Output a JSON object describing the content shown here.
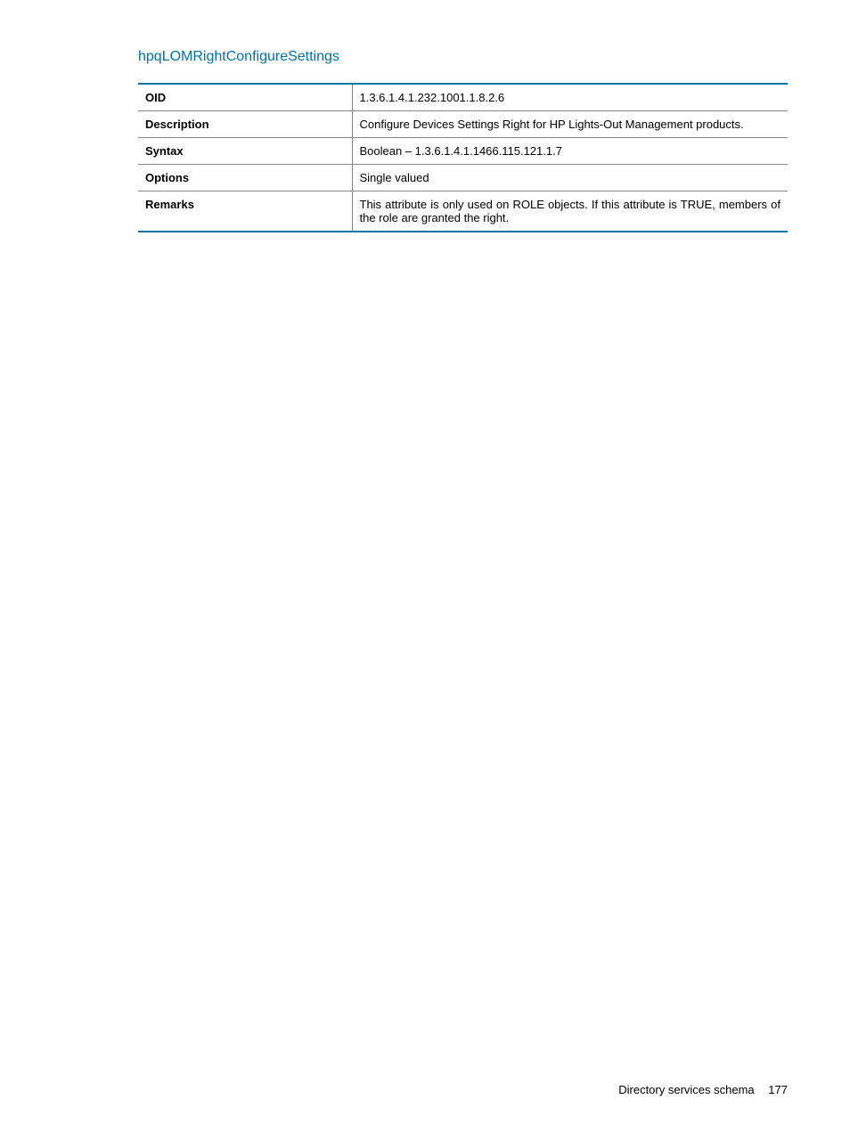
{
  "section_title": "hpqLOMRightConfigureSettings",
  "table_rows": [
    {
      "key": "OID",
      "value": "1.3.6.1.4.1.232.1001.1.8.2.6"
    },
    {
      "key": "Description",
      "value": "Configure Devices Settings Right for HP Lights-Out Management products."
    },
    {
      "key": "Syntax",
      "value": "Boolean – 1.3.6.1.4.1.1466.115.121.1.7"
    },
    {
      "key": "Options",
      "value": "Single valued"
    },
    {
      "key": "Remarks",
      "value": "This attribute is only used on ROLE objects. If this attribute is TRUE, members of the role are granted the right."
    }
  ],
  "footer": {
    "text": "Directory services schema",
    "page": "177"
  }
}
